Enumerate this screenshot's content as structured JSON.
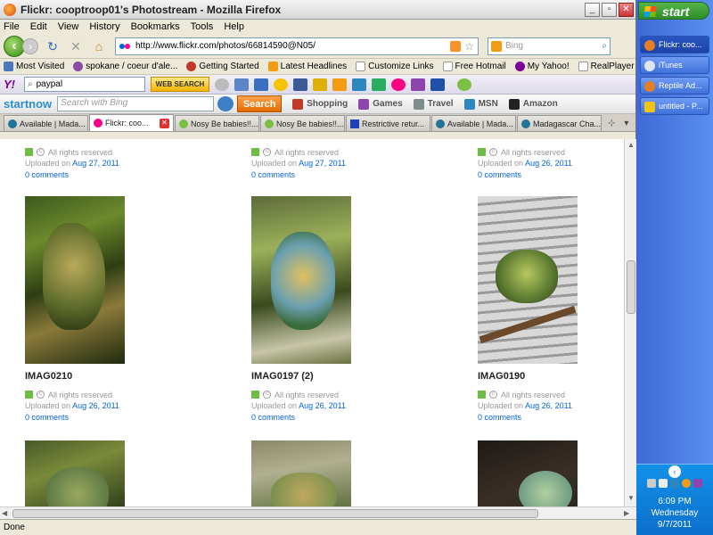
{
  "window": {
    "title": "Flickr: cooptroop01's Photostream - Mozilla Firefox"
  },
  "menu": [
    "File",
    "Edit",
    "View",
    "History",
    "Bookmarks",
    "Tools",
    "Help"
  ],
  "nav": {
    "url": "http://www.flickr.com/photos/66814590@N05/",
    "search_placeholder": "Bing"
  },
  "bookmarks": [
    "Most Visited",
    "spokane / coeur d'ale...",
    "Getting Started",
    "Latest Headlines",
    "Customize Links",
    "Free Hotmail",
    "My Yahoo!",
    "RealPlayer"
  ],
  "yahoo_toolbar": {
    "logo": "Y!",
    "search_value": "paypal",
    "web_search_label": "WEB SEARCH"
  },
  "startnow_toolbar": {
    "logo": "startnow",
    "search_placeholder": "Search with Bing",
    "search_button": "Search",
    "links": [
      "Shopping",
      "Games",
      "Travel",
      "MSN",
      "Amazon"
    ]
  },
  "tabs": [
    {
      "label": "Available | Mada...",
      "active": false
    },
    {
      "label": "Flickr: coo...",
      "active": true
    },
    {
      "label": "Nosy Be babies!!...",
      "active": false
    },
    {
      "label": "Nosy Be babies!!...",
      "active": false
    },
    {
      "label": "Restrictive retur...",
      "active": false
    },
    {
      "label": "Available | Mada...",
      "active": false
    },
    {
      "label": "Madagascar Cha...",
      "active": false
    }
  ],
  "photos": {
    "rights_text": "All rights reserved",
    "uploaded_prefix": "Uploaded on",
    "top_row": [
      {
        "date": "Aug 27, 2011",
        "comments": "0 comments"
      },
      {
        "date": "Aug 27, 2011",
        "comments": "0 comments"
      },
      {
        "date": "Aug 26, 2011",
        "comments": "0 comments"
      }
    ],
    "middle_row": [
      {
        "title": "IMAG0210",
        "date": "Aug 26, 2011",
        "comments": "0 comments"
      },
      {
        "title": "IMAG0197 (2)",
        "date": "Aug 26, 2011",
        "comments": "0 comments"
      },
      {
        "title": "IMAG0190",
        "date": "Aug 26, 2011",
        "comments": "0 comments"
      }
    ]
  },
  "status": "Done",
  "taskbar": {
    "start_label": "start",
    "items": [
      {
        "label": "Flickr: coo...",
        "active": true
      },
      {
        "label": "iTunes",
        "active": false
      },
      {
        "label": "Reptile Ad...",
        "active": false
      },
      {
        "label": "untitled - P...",
        "active": false
      }
    ],
    "time": "6:09 PM",
    "day": "Wednesday",
    "date": "9/7/2011"
  }
}
